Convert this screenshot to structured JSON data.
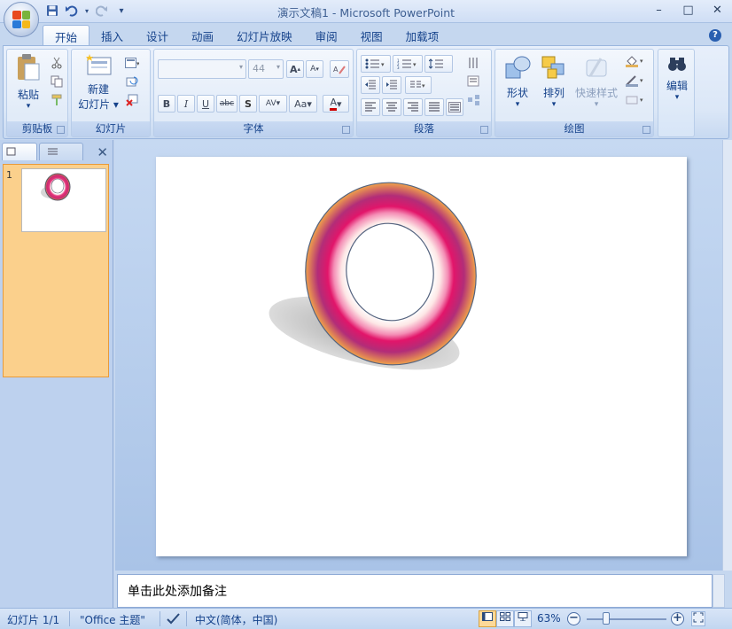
{
  "window": {
    "title": "演示文稿1 - Microsoft PowerPoint",
    "minimize": "–",
    "maximize": "□",
    "close": "✕"
  },
  "qat": {
    "save_icon": "save-icon",
    "undo_icon": "undo-icon",
    "redo_icon": "redo-icon",
    "customize": "▾"
  },
  "tabs": [
    "开始",
    "插入",
    "设计",
    "动画",
    "幻灯片放映",
    "审阅",
    "视图",
    "加载项"
  ],
  "ribbon": {
    "clipboard": {
      "label": "剪贴板",
      "paste": "粘贴"
    },
    "slides": {
      "label": "幻灯片",
      "new_slide_line1": "新建",
      "new_slide_line2": "幻灯片 ▾"
    },
    "font": {
      "label": "字体",
      "font_size": "44",
      "bold": "B",
      "italic": "I",
      "underline": "U",
      "strike": "abc",
      "shadow": "S",
      "spacing": "AV",
      "case": "Aa",
      "color": "A",
      "grow": "A",
      "shrink": "A"
    },
    "paragraph": {
      "label": "段落"
    },
    "drawing": {
      "label": "绘图",
      "shapes": "形状",
      "arrange": "排列",
      "quick_styles": "快速样式"
    },
    "editing": {
      "label": "编辑"
    }
  },
  "slide_panel": {
    "thumb_number": "1"
  },
  "notes": {
    "placeholder": "单击此处添加备注"
  },
  "status": {
    "slide": "幻灯片 1/1",
    "theme": "\"Office 主题\"",
    "language": "中文(简体，中国)",
    "zoom": "63%"
  },
  "colors": {
    "accent": "#15428b",
    "ribbon_bg": "#dbe7f7",
    "ring_outer": "#f0a24a",
    "ring_mid": "#d0145a"
  }
}
